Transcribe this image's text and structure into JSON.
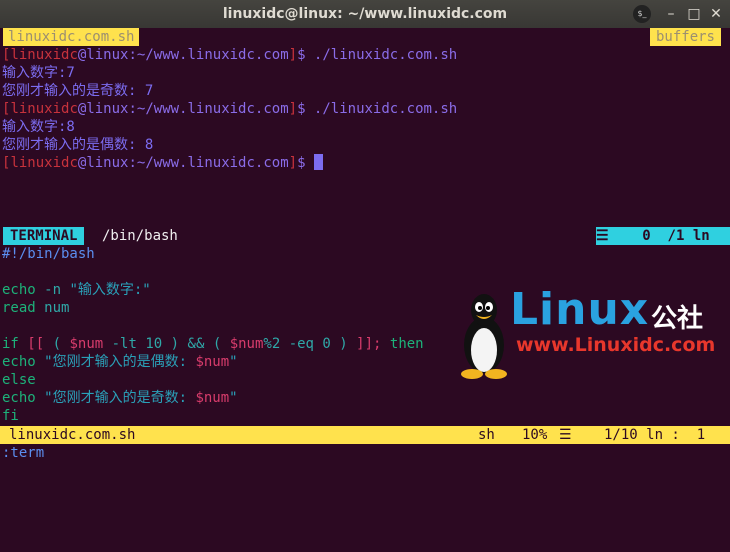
{
  "window": {
    "title": "linuxidc@linux: ~/www.linuxidc.com"
  },
  "tabline": {
    "current_tab": "linuxidc.com.sh",
    "buffers_label": "buffers"
  },
  "terminal": {
    "lines": [
      {
        "user": "linuxidc",
        "host": "linux",
        "path": "~/www.linuxidc.com",
        "command": "./linuxidc.com.sh"
      },
      {
        "text": "输入数字:7"
      },
      {
        "text": "您刚才输入的是奇数: 7"
      },
      {
        "user": "linuxidc",
        "host": "linux",
        "path": "~/www.linuxidc.com",
        "command": "./linuxidc.com.sh"
      },
      {
        "text": "输入数字:8"
      },
      {
        "text": "您刚才输入的是偶数: 8"
      },
      {
        "user": "linuxidc",
        "host": "linux",
        "path": "~/www.linuxidc.com",
        "command": ""
      }
    ]
  },
  "terminal_status": {
    "mode": "TERMINAL",
    "name": "/bin/bash",
    "right": "☰    0  /1 ln"
  },
  "editor": {
    "shebang": "#!/bin/bash",
    "echo_kw": "echo",
    "echo_flag": "-n",
    "prompt_str": "\"输入数字:\"",
    "read_kw": "read",
    "read_var": "num",
    "if_kw": "if",
    "cond_open": "[[",
    "paren_open": "(",
    "cond_var": "$num",
    "cond_op": "-lt 10",
    "paren_close": ")",
    "and_op": "&&",
    "paren2_open": "(",
    "mod_var": "$num",
    "mod_rest": "%2 -eq 0",
    "paren2_close": ")",
    "cond_close": "]];",
    "then_kw": "then",
    "echo_even": "\"您刚才输入的是偶数: ",
    "echo_even_var": "$num",
    "else_kw": "else",
    "echo_odd": "\"您刚才输入的是奇数: ",
    "echo_odd_var": "$num",
    "fi_kw": "fi",
    "quote_end": "\""
  },
  "file_status": {
    "filename": "linuxidc.com.sh",
    "filetype": "sh",
    "percent": "10%",
    "icon": "☰",
    "position": "1/10 ln :  1"
  },
  "cmdline": ":term",
  "watermark": {
    "brand": "Linux",
    "brand_cn": "公社",
    "url": "www.Linuxidc.com"
  },
  "colors": {
    "background": "#2c0922",
    "tab_yellow": "#ffe24d",
    "term_cyan": "#2fd0e0",
    "prompt_red": "#c8323c",
    "prompt_purple": "#8a6ce8"
  }
}
